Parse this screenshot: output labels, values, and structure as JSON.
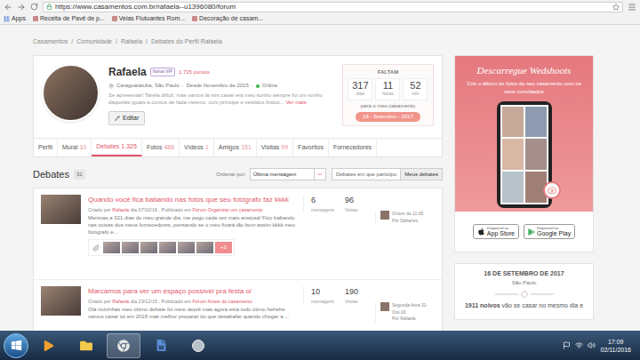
{
  "browser": {
    "url": "https://www.casamentos.com.br/rafaela--u1396080/forum",
    "bookmarks": [
      "Apps",
      "Receita de Pavê de p...",
      "Velas Flutuantes Rom...",
      "Decoração de casam..."
    ]
  },
  "breadcrumb": {
    "separator": "/",
    "items": [
      "Casamentos",
      "Comunidade",
      "Rafaela",
      "Debates do Perfil Rafaela"
    ]
  },
  "profile": {
    "name": "Rafaela",
    "badge": "Noiva VIP",
    "points": "1.715 pontos",
    "location": "Caraguatatuba, São Paulo",
    "separator": "·",
    "since": "Desde Novembro de 2015",
    "status": "Online",
    "bio": "Se apresentar! Tarefa difícil, mas vamos lá rsrs casar era meu sonho sempre fui um sonho daquelas iguais a contos de fada mesmo, com príncipe e vestidos lindos...",
    "more": "Ver mais",
    "edit": "Editar"
  },
  "countdown": {
    "label": "FALTAM",
    "units": [
      {
        "value": "317",
        "unit": "dias"
      },
      {
        "value": "11",
        "unit": "horas"
      },
      {
        "value": "52",
        "unit": "min"
      }
    ],
    "caption": "para o meu casamento",
    "date": "16 - Setembro - 2017"
  },
  "tabs": [
    {
      "label": "Perfil",
      "selected": false
    },
    {
      "label": "Mural",
      "count": "10",
      "selected": false
    },
    {
      "label": "Debates",
      "count": "1.325",
      "selected": true
    },
    {
      "label": "Fotos",
      "count": "486",
      "selected": false
    },
    {
      "label": "Vídeos",
      "count": "1",
      "selected": false
    },
    {
      "label": "Amigos",
      "count": "151",
      "selected": false
    },
    {
      "label": "Visitas",
      "count": "99",
      "selected": false
    },
    {
      "label": "Favoritos",
      "selected": false
    },
    {
      "label": "Fornecedores",
      "selected": false
    }
  ],
  "debates": {
    "title": "Debates",
    "count": "31",
    "sort_label": "Ordenar por:",
    "sort_value": "Última mensagem",
    "filters": [
      {
        "label": "Debates em que participo",
        "selected": false
      },
      {
        "label": "Meus debates",
        "selected": true
      }
    ],
    "items": [
      {
        "title": "Quando você fica babando nas fotos que seu fotógrafo faz kkkk",
        "created": "Criado por",
        "author": "Rafaela",
        "date": "dia 07/10/16 , Publicado em",
        "forum": "Fórum Organizar um casamento",
        "excerpt": "Meninas a 321 dias do meu grande dia, me pego cada vez mais ansiosa! Fico babando nas coisas dos meus fornecedores, pensando se o meu ficará tão bom assim kkkk meu fotógrafo e...",
        "thumbnails": 6,
        "more": "+3",
        "messages": "6",
        "messages_label": "mensagens",
        "visits": "96",
        "visits_label": "Visitas",
        "last_when": "Ontem às 11:05",
        "last_by": "Por Daharies"
      },
      {
        "title": "Marcamos para ver um espaço possível pra festa o/",
        "created": "Criado por",
        "author": "Rafaela",
        "date": "dia 23/12/15 , Publicado em",
        "forum": "Fórum Antes do casamento",
        "excerpt": "Olá noivinhas meu último debate foi meio deprê mas agora está tudo ótimo hehehe vamos casar só em 2018 mas melhor preparar do que desabafar quando chegar a ...",
        "thumbnails": 0,
        "more": "",
        "messages": "10",
        "messages_label": "mensagens",
        "visits": "190",
        "visits_label": "Visitas",
        "last_when": "Segunda-feira 31-Out-16",
        "last_by": "Por Rafaela"
      }
    ]
  },
  "sidebar": {
    "promo": {
      "title": "Descarregue Wedshoots",
      "text": "Crie o álbum de fotos do seu casamento com os seus convidados",
      "stores": [
        {
          "small": "Disponível na",
          "name": "App Store"
        },
        {
          "small": "Disponível no",
          "name": "Google Play"
        }
      ]
    },
    "date_card": {
      "date": "16 DE SETEMBRO DE 2017",
      "city": "São Paulo",
      "count": "1911 noivos",
      "rest": "vão se casar no mesmo dia e"
    }
  },
  "taskbar": {
    "time": "17:09",
    "date": "02/11/2016"
  }
}
